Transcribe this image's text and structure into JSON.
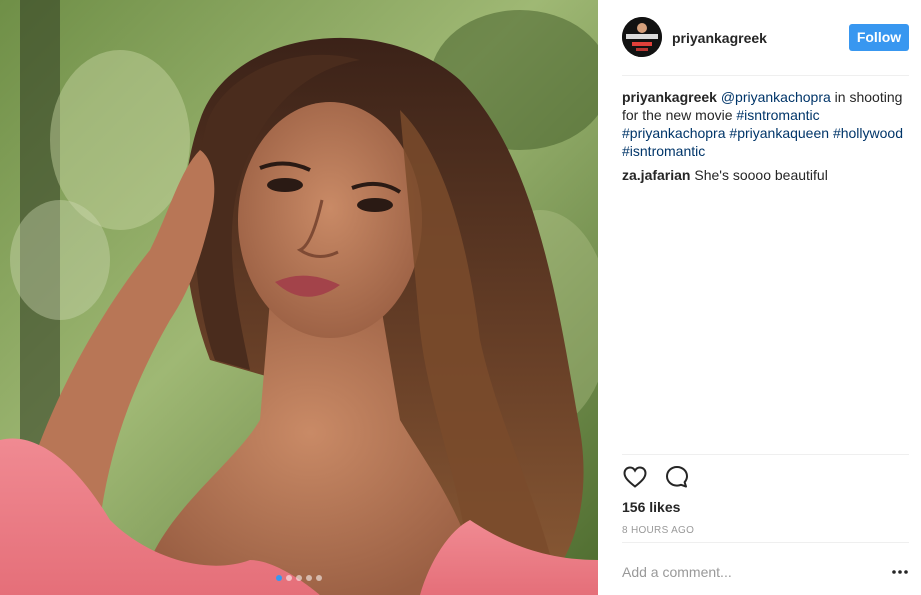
{
  "post": {
    "image_alt": "Woman with long wavy brown hair in a pink dress, hand raised to her hair, green blurred background",
    "carousel": {
      "count": 5,
      "active_index": 0
    }
  },
  "header": {
    "username": "priyankagreek",
    "follow_label": "Follow",
    "avatar_text": "PRIYANKA CHOPRA"
  },
  "caption": {
    "username": "priyankagreek",
    "mention": "@priyankachopra",
    "text_middle": " in shooting for the new movie ",
    "hashtags": [
      "#isntromantic",
      "#priyankachopra",
      "#priyankaqueen",
      "#hollywood",
      "#isntromantic"
    ]
  },
  "comments": [
    {
      "username": "za.jafarian",
      "text": "She's soooo beautiful"
    }
  ],
  "actions": {
    "like_icon": "heart-icon",
    "comment_icon": "comment-bubble-icon"
  },
  "likes_label": "156 likes",
  "timestamp": "8 HOURS AGO",
  "add_comment": {
    "placeholder": "Add a comment..."
  },
  "more_icon": "more-options-icon",
  "colors": {
    "accent": "#3897f0",
    "link": "#003569",
    "muted": "#999999",
    "divider": "#efefef"
  }
}
